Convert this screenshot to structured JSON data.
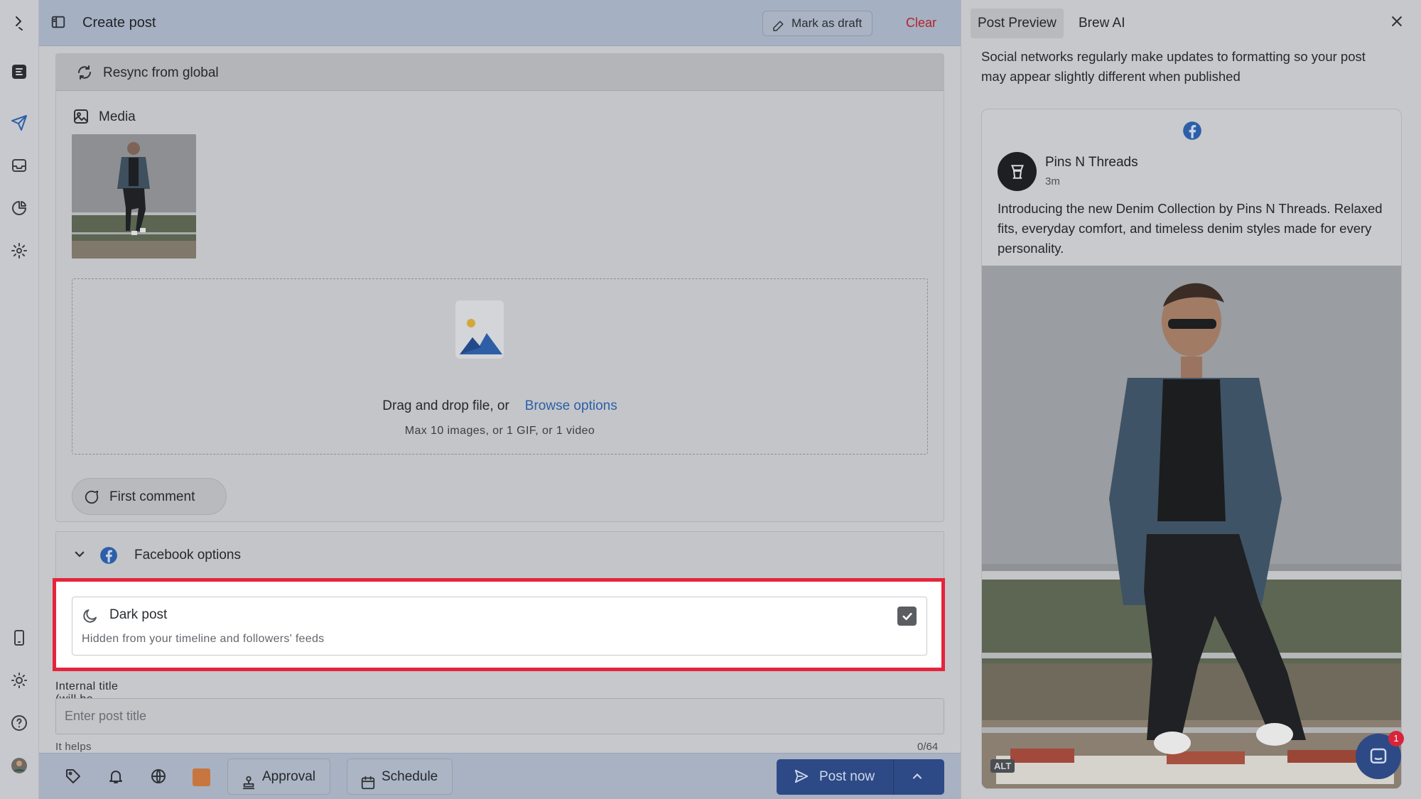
{
  "header": {
    "title": "Create post",
    "mark_draft": "Mark as draft",
    "clear": "Clear"
  },
  "editor": {
    "resync": "Resync from global",
    "media_label": "Media",
    "drop_text": "Drag and drop file, or",
    "browse": "Browse options",
    "limits": "Max 10 images, or 1 GIF, or 1 video",
    "first_comment": "First comment",
    "facebook_options": "Facebook options",
    "dark_post": {
      "title": "Dark post",
      "subtitle": "Hidden from your timeline and followers' feeds",
      "checked": true
    },
    "internal_title": {
      "label": "Internal title (will be used within Statusbrew)",
      "placeholder": "Enter post title",
      "value": "",
      "helper": "It helps easily tell apart posts created for different purposes",
      "counter": "0/64"
    }
  },
  "bottombar": {
    "approval": "Approval",
    "schedule": "Schedule",
    "post_now": "Post now",
    "swatch_color": "#c7763f"
  },
  "preview": {
    "tabs": [
      "Post Preview",
      "Brew AI"
    ],
    "active_tab": "Post Preview",
    "notice": "Social networks regularly make updates to formatting so your post may appear slightly different when published",
    "page_name": "Pins N Threads",
    "time": "3m",
    "post_text": "Introducing the new Denim Collection by Pins N Threads. Relaxed fits, everyday comfort, and timeless denim styles made for every personality.",
    "alt_badge": "ALT"
  },
  "chat": {
    "badge": "1"
  },
  "colors": {
    "highlight": "#e5243b",
    "primary": "#2d4a86",
    "link": "#2d5fa8",
    "danger": "#b2232b"
  },
  "icons": {
    "rail": [
      "statusbrew-logo-icon",
      "brand-icon",
      "send-icon",
      "inbox-icon",
      "reports-icon",
      "settings-icon",
      "mobile-icon",
      "theme-icon",
      "help-icon",
      "user-avatar"
    ]
  }
}
